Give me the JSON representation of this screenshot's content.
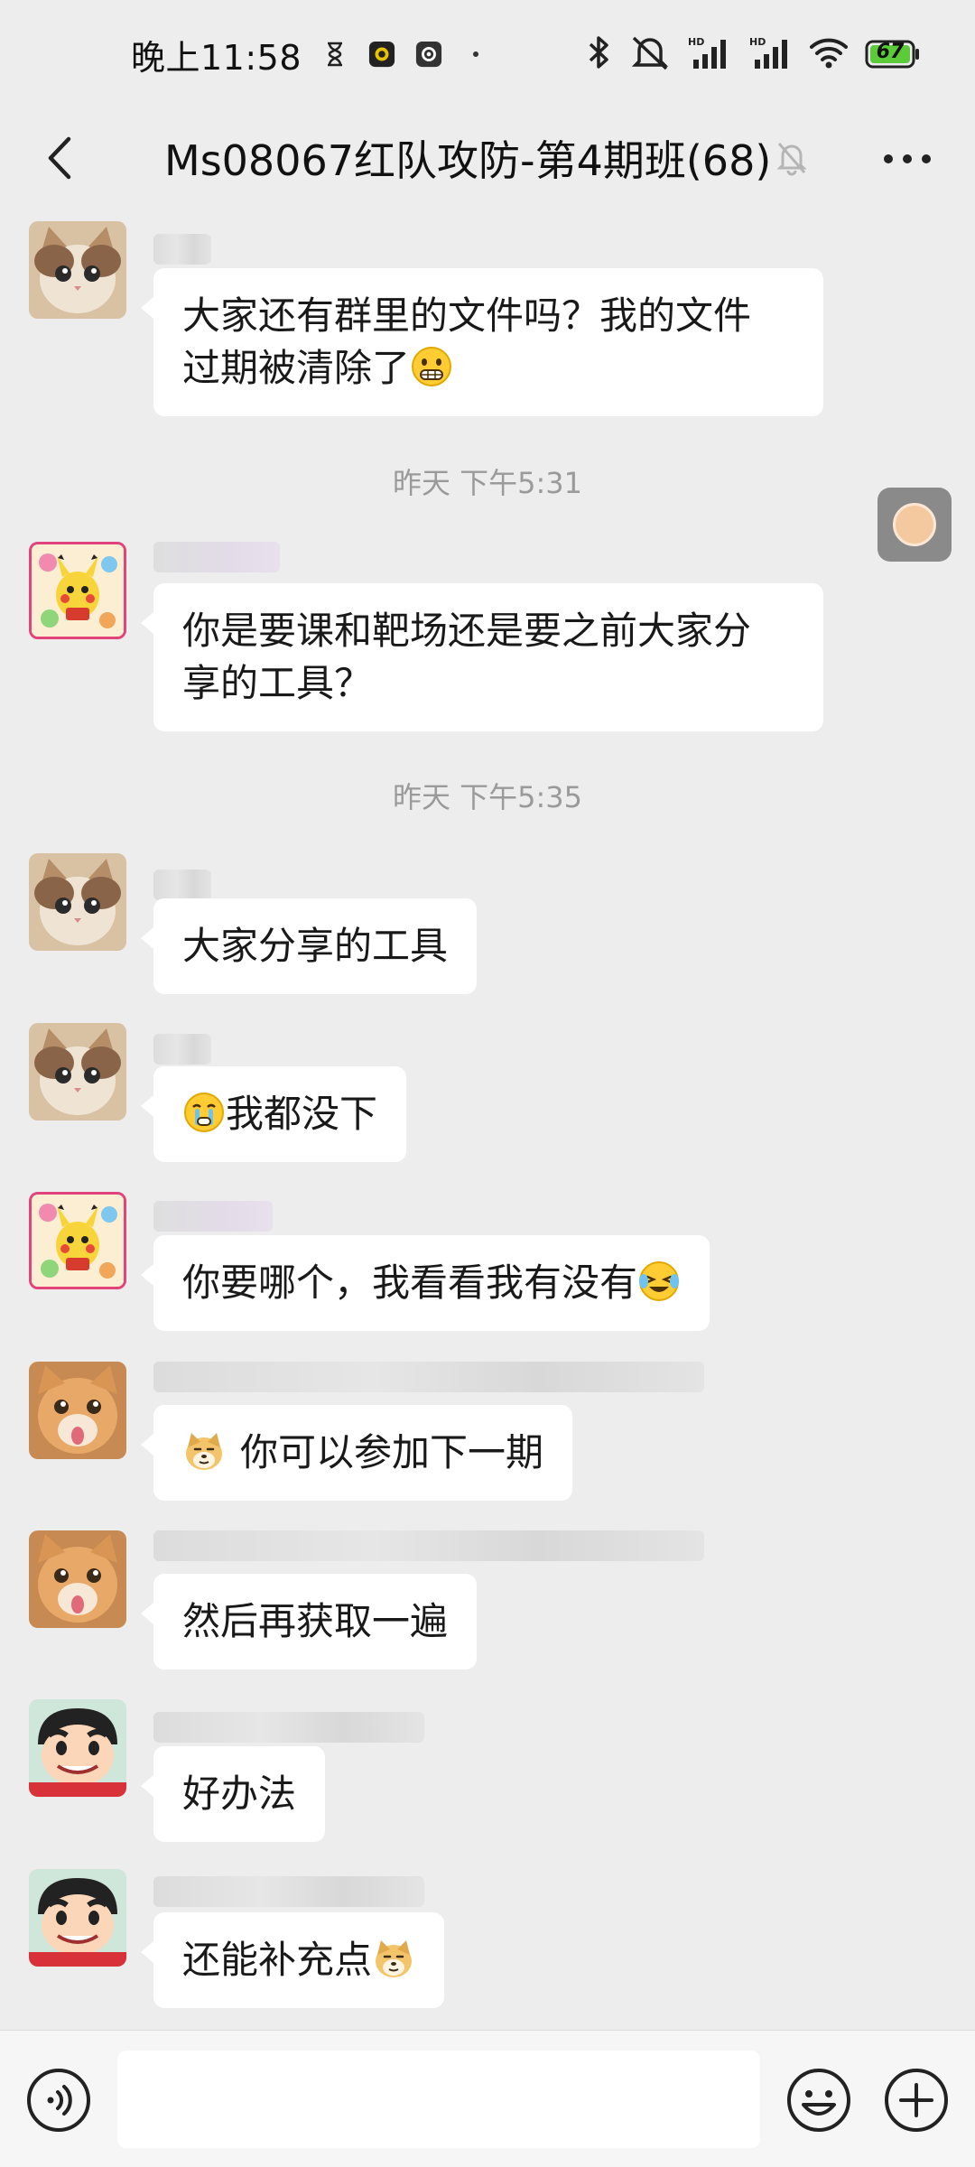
{
  "status_bar": {
    "time": "晚上11:58",
    "battery": "67"
  },
  "header": {
    "title": "Ms08067红队攻防-第4期班(68)"
  },
  "messages": [
    {
      "avatar": "cat-avatar",
      "text": "大家还有群里的文件吗？我的文件过期被清除了",
      "line1": "大家还有群里的文件吗？我的文件",
      "line2": "过期被清除了",
      "emoji_after": "grimacing-face-emoji"
    },
    {
      "avatar": "pikachu-avatar",
      "line1": "你是要课和靶场还是要之前大家分",
      "line2": "享的工具？"
    },
    {
      "avatar": "cat-avatar",
      "text": "大家分享的工具"
    },
    {
      "avatar": "cat-avatar",
      "text": "我都没下",
      "emoji_before": "crying-face-emoji"
    },
    {
      "avatar": "pikachu-avatar",
      "text": "你要哪个，我看看我有没有",
      "emoji_after": "laughing-tears-emoji"
    },
    {
      "avatar": "orange-cat-avatar",
      "text": "你可以参加下一期",
      "emoji_before": "doge-emoji"
    },
    {
      "avatar": "orange-cat-avatar",
      "text": "然后再获取一遍"
    },
    {
      "avatar": "crayon-shin-avatar",
      "text": "好办法"
    },
    {
      "avatar": "crayon-shin-avatar",
      "text": "还能补充点",
      "emoji_after": "doge-emoji"
    }
  ],
  "timestamps": [
    "昨天 下午5:31",
    "昨天 下午5:35"
  ],
  "input": {
    "placeholder": ""
  }
}
